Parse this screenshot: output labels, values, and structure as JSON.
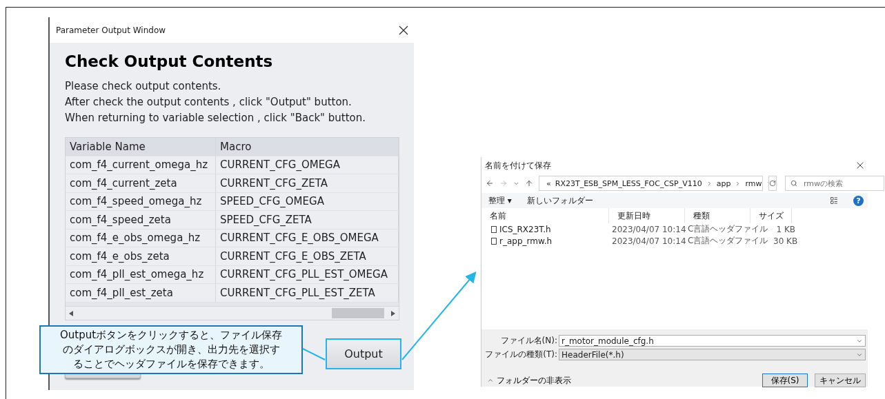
{
  "parameter_window": {
    "title": "Parameter Output Window",
    "heading": "Check Output Contents",
    "instructions": [
      "Please check output contents.",
      "After check the output contents , click \"Output\" button.",
      "When returning to variable selection , click \"Back\" button."
    ],
    "table": {
      "columns": [
        "Variable Name",
        "Macro"
      ],
      "rows": [
        [
          "com_f4_current_omega_hz",
          "CURRENT_CFG_OMEGA"
        ],
        [
          "com_f4_current_zeta",
          "CURRENT_CFG_ZETA"
        ],
        [
          "com_f4_speed_omega_hz",
          "SPEED_CFG_OMEGA"
        ],
        [
          "com_f4_speed_zeta",
          "SPEED_CFG_ZETA"
        ],
        [
          "com_f4_e_obs_omega_hz",
          "CURRENT_CFG_E_OBS_OMEGA"
        ],
        [
          "com_f4_e_obs_zeta",
          "CURRENT_CFG_E_OBS_ZETA"
        ],
        [
          "com_f4_pll_est_omega_hz",
          "CURRENT_CFG_PLL_EST_OMEGA"
        ],
        [
          "com_f4_pll_est_zeta",
          "CURRENT_CFG_PLL_EST_ZETA"
        ]
      ]
    },
    "output_button": "Output"
  },
  "callout": {
    "lines": [
      "Outputボタンをクリックすると、ファイル保存",
      "のダイアログボックスが開き、出力先を選択す",
      "ることでヘッダファイルを保存できます。"
    ]
  },
  "save_dialog": {
    "title": "名前を付けて保存",
    "path_prefix": "«",
    "path": [
      "RX23T_ESB_SPM_LESS_FOC_CSP_V110",
      "app",
      "rmw"
    ],
    "search": {
      "placeholder": "rmwの検索"
    },
    "toolbar": {
      "organize": "整理 ▾",
      "new_folder": "新しいフォルダー",
      "help": "?"
    },
    "columns": [
      "名前",
      "更新日時",
      "種類",
      "サイズ"
    ],
    "files": [
      {
        "name": "ICS_RX23T.h",
        "modified": "2023/04/07 10:14",
        "type": "C言語ヘッダファイル",
        "size": "1 KB"
      },
      {
        "name": "r_app_rmw.h",
        "modified": "2023/04/07 10:14",
        "type": "C言語ヘッダファイル",
        "size": "30 KB"
      }
    ],
    "file_name": {
      "label": "ファイル名(N):",
      "value": "r_motor_module_cfg.h"
    },
    "file_type": {
      "label": "ファイルの種類(T):",
      "value": "HeaderFile(*.h)"
    },
    "hide_folders": "フォルダーの非表示",
    "save_button": "保存(S)",
    "cancel_button": "キャンセル"
  }
}
